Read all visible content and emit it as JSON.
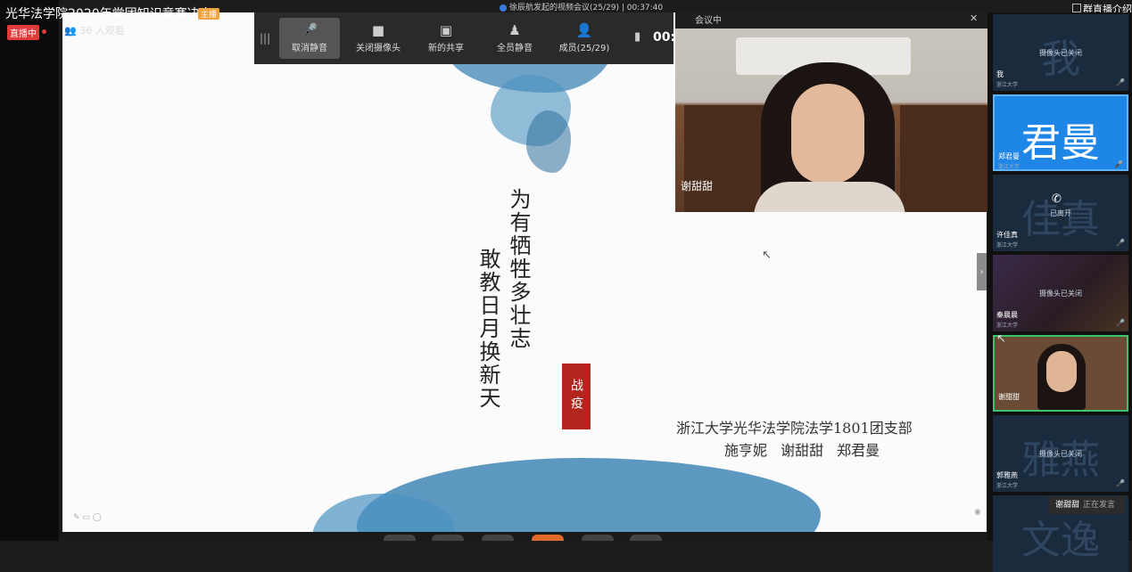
{
  "stream": {
    "title": "光华法学院2020年党团知识竞赛决赛",
    "host_badge": "主播",
    "live_badge": "直播中",
    "viewers": "36 人观看",
    "meeting_info": "徐辰航发起的视频会议(25/29)  |  00:37:40",
    "intro_button": "群直播介绍"
  },
  "toolbar": {
    "buttons": [
      {
        "label": "取消静音",
        "icon": "microphone-icon"
      },
      {
        "label": "关闭摄像头",
        "icon": "camera-icon"
      },
      {
        "label": "新的共享",
        "icon": "share-icon"
      },
      {
        "label": "全员静音",
        "icon": "mute-all-icon"
      },
      {
        "label": "成员(25/29)",
        "icon": "members-icon"
      }
    ],
    "timer": "00:3"
  },
  "slide": {
    "poem_right": "为有牺牲多壮志",
    "poem_left": "敢教日月换新天",
    "seal_text": "战疫",
    "org_line": "浙江大学光华法学院法学1801团支部",
    "names": "施亨妮 谢甜甜 郑君曼",
    "ink_color": "#3f86b5"
  },
  "speaker": {
    "top_label": "会议中",
    "name": "谢甜甜"
  },
  "participants": [
    {
      "big": "我",
      "status": "摄像头已关闭",
      "name": "我",
      "org": "浙江大学"
    },
    {
      "big": "君曼",
      "status": "",
      "name": "郑君曼",
      "org": "浙江大学"
    },
    {
      "big": "佳真",
      "status": "已离开",
      "name": "许佳真",
      "org": "浙江大学"
    },
    {
      "big": "",
      "status": "摄像头已关闭",
      "name": "秦晨晨",
      "org": "浙江大学"
    },
    {
      "big": "",
      "status": "",
      "name": "谢甜甜",
      "org": ""
    },
    {
      "big": "雅燕",
      "status": "摄像头已关闭",
      "name": "郭雅燕",
      "org": "浙江大学"
    },
    {
      "big": "文逸",
      "status": "",
      "name": "",
      "org": ""
    }
  ],
  "speaking_toast": {
    "name": "谢甜甜",
    "status": "正在发言"
  }
}
